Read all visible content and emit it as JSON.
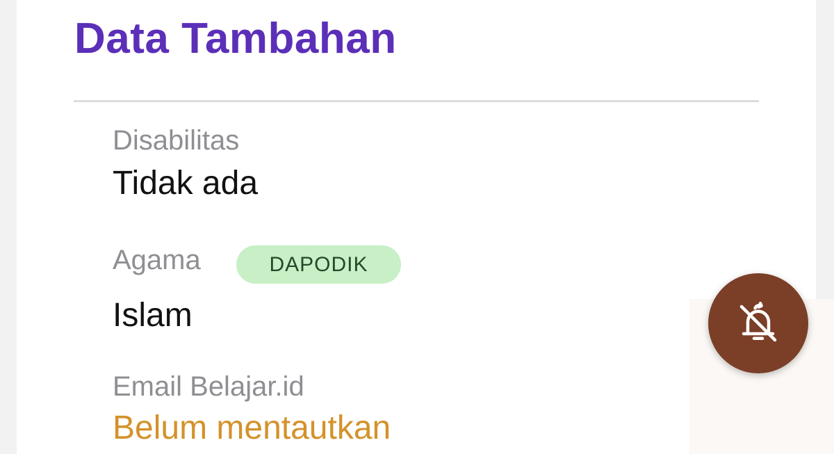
{
  "section": {
    "title": "Data Tambahan"
  },
  "fields": [
    {
      "label": "Disabilitas",
      "value": "Tidak ada"
    },
    {
      "label": "Agama",
      "badge": "DAPODIK",
      "value": "Islam"
    },
    {
      "label": "Email Belajar.id",
      "value": "Belum mentautkan"
    }
  ],
  "fab": {
    "icon": "notifications-off-sync-icon"
  },
  "colors": {
    "title": "#5b2fb8",
    "badge_bg": "#c8efc5",
    "warning_text": "#d3922a",
    "fab_bg": "#7b3e26"
  }
}
